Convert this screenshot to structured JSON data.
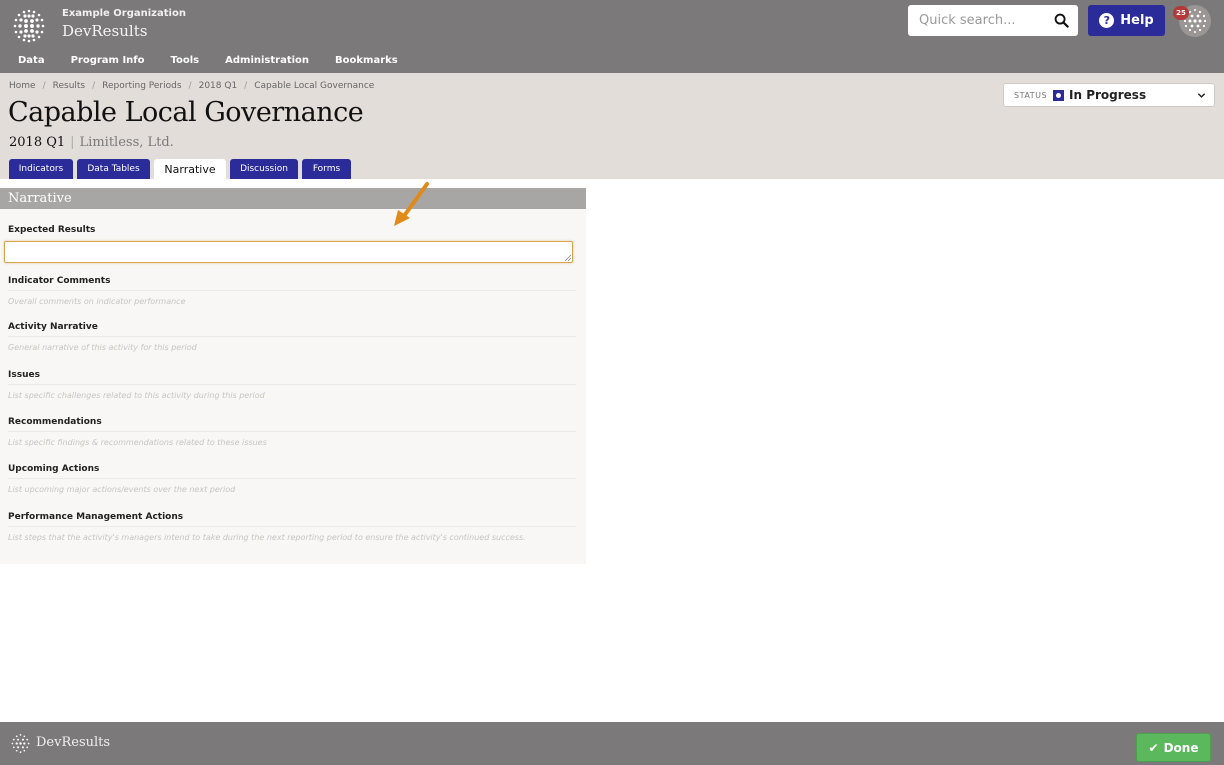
{
  "header": {
    "org_name": "Example Organization",
    "app_name": "DevResults",
    "nav": [
      "Data",
      "Program Info",
      "Tools",
      "Administration",
      "Bookmarks"
    ],
    "search_placeholder": "Quick search...",
    "help_label": "Help",
    "notification_count": "25"
  },
  "breadcrumb": [
    "Home",
    "Results",
    "Reporting Periods",
    "2018 Q1",
    "Capable Local Governance"
  ],
  "page": {
    "title": "Capable Local Governance",
    "period": "2018 Q1",
    "organization": "Limitless, Ltd.",
    "status_label": "STATUS",
    "status_value": "In Progress"
  },
  "tabs": [
    "Indicators",
    "Data Tables",
    "Narrative",
    "Discussion",
    "Forms"
  ],
  "active_tab": "Narrative",
  "narrative": {
    "heading": "Narrative",
    "fields": [
      {
        "label": "Expected Results",
        "placeholder": ""
      },
      {
        "label": "Indicator Comments",
        "placeholder": "Overall comments on indicator performance"
      },
      {
        "label": "Activity Narrative",
        "placeholder": "General narrative of this activity for this period"
      },
      {
        "label": "Issues",
        "placeholder": "List specific challenges related to this activity during this period"
      },
      {
        "label": "Recommendations",
        "placeholder": "List specific findings & recommendations related to these issues"
      },
      {
        "label": "Upcoming Actions",
        "placeholder": "List upcoming major actions/events over the next period"
      },
      {
        "label": "Performance Management Actions",
        "placeholder": "List steps that the activity's managers intend to take during the next reporting period to ensure the activity's continued success."
      }
    ]
  },
  "footer": {
    "brand": "DevResults",
    "done_label": "Done"
  },
  "colors": {
    "header_bg": "#7b7979",
    "accent": "#2b2c9a",
    "subheader_bg": "#e3ddd9",
    "done_green": "#5cb85c",
    "annotation_arrow": "#e08a1a"
  }
}
